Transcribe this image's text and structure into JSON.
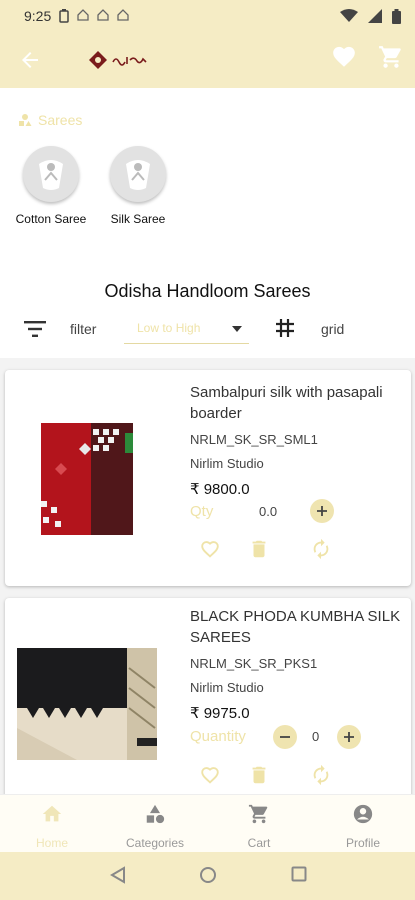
{
  "status": {
    "time": "9:25"
  },
  "categories": {
    "heading": "Sarees",
    "items": [
      {
        "label": "Cotton Saree"
      },
      {
        "label": "Silk Saree"
      }
    ]
  },
  "page": {
    "title": "Odisha Handloom Sarees"
  },
  "toolbar": {
    "filter_label": "filter",
    "sort_value": "Low to High",
    "grid_label": "grid"
  },
  "products": [
    {
      "name": "Sambalpuri silk with pasapali boarder",
      "sku": "NRLM_SK_SR_SML1",
      "seller": "Nirlim Studio",
      "price": "₹ 9800.0",
      "qty_label": "Qty",
      "qty": "0.0"
    },
    {
      "name": "BLACK PHODA KUMBHA SILK SAREES",
      "sku": "NRLM_SK_SR_PKS1",
      "seller": "Nirlim Studio",
      "price": "₹ 9975.0",
      "qty_label": "Quantity",
      "qty": "0"
    }
  ],
  "nav": {
    "home": "Home",
    "categories": "Categories",
    "cart": "Cart",
    "profile": "Profile"
  },
  "colors": {
    "accent": "#f5ecc5",
    "accent_text": "#efe3a8",
    "brand_red": "#7a1c1c"
  }
}
